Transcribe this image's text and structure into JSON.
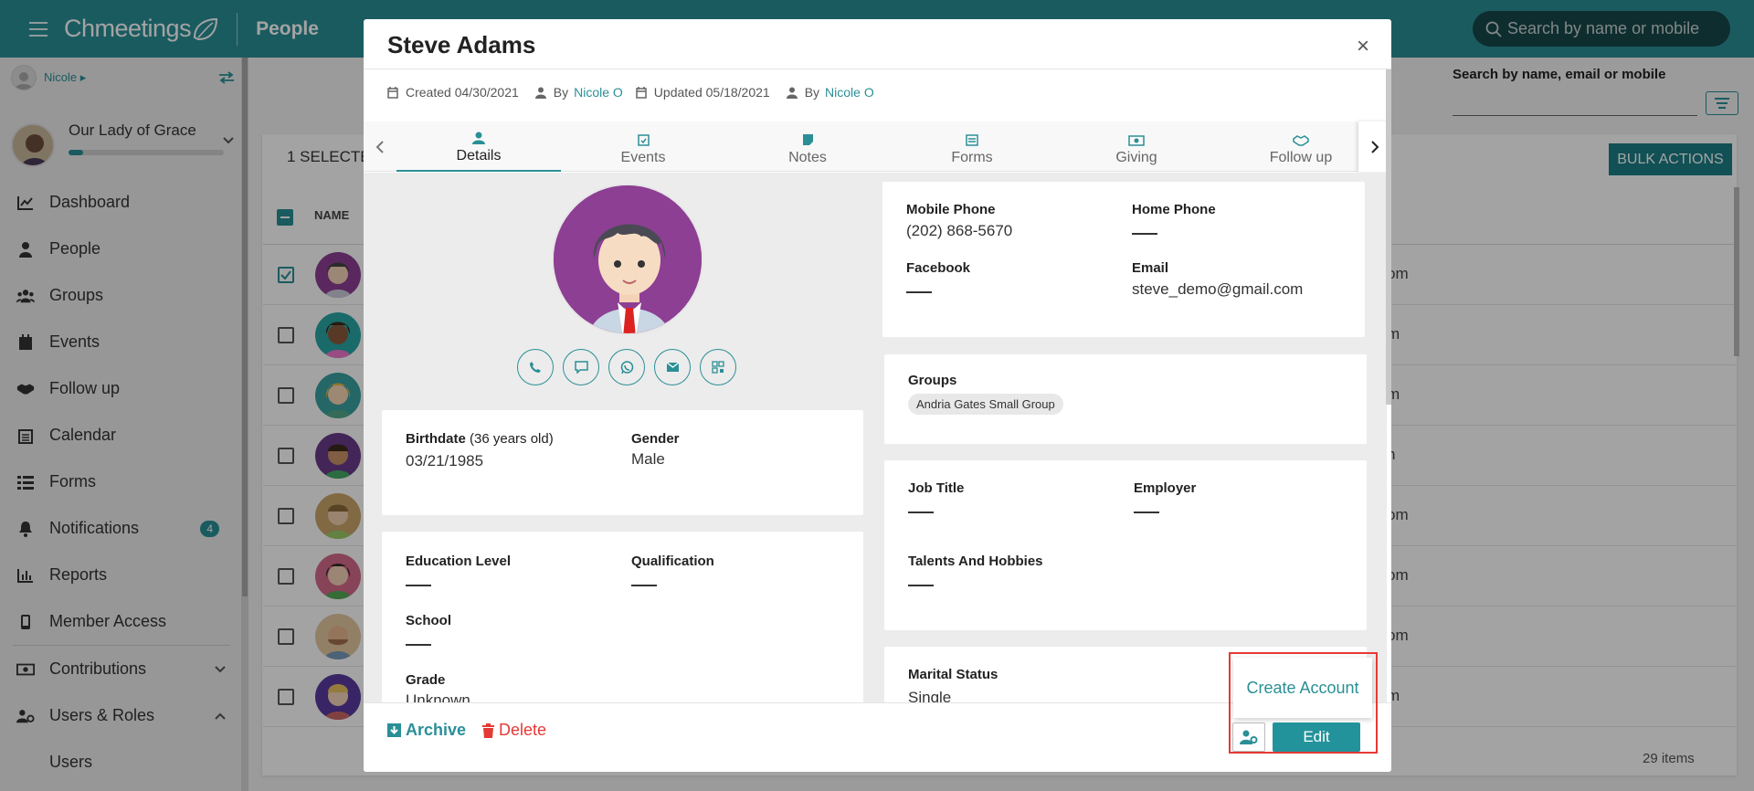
{
  "app": {
    "brand": "Chmeetings",
    "page_title": "People",
    "search_placeholder": "Search by name or mobile"
  },
  "sidebar": {
    "user": "Nicole",
    "church": {
      "name": "Our Lady of Grace"
    },
    "items": [
      {
        "label": "Dashboard",
        "icon": "chart-line-icon"
      },
      {
        "label": "People",
        "icon": "person-icon"
      },
      {
        "label": "Groups",
        "icon": "users-group-icon"
      },
      {
        "label": "Events",
        "icon": "calendar-icon"
      },
      {
        "label": "Follow up",
        "icon": "handshake-icon"
      },
      {
        "label": "Calendar",
        "icon": "calendar-grid-icon"
      },
      {
        "label": "Forms",
        "icon": "list-icon"
      },
      {
        "label": "Notifications",
        "icon": "bell-icon",
        "badge": "4"
      },
      {
        "label": "Reports",
        "icon": "bar-chart-icon"
      },
      {
        "label": "Member Access",
        "icon": "mobile-icon"
      },
      {
        "label": "Contributions",
        "icon": "money-icon"
      },
      {
        "label": "Users & Roles",
        "icon": "user-cog-icon"
      },
      {
        "label": "Users",
        "icon": ""
      }
    ]
  },
  "people_list": {
    "search_label": "Search by name, email or mobile",
    "selected_text": "1 SELECTE",
    "bulk_actions": "BULK ACTIONS",
    "column_name": "NAME",
    "row_emails": [
      "om",
      "m",
      "m",
      "n",
      "om",
      "om",
      "om",
      "m"
    ],
    "total": "29 items"
  },
  "modal": {
    "name": "Steve Adams",
    "close": "×",
    "meta": {
      "created": "Created 04/30/2021",
      "by_label": "By",
      "created_by": "Nicole O",
      "updated": "Updated 05/18/2021",
      "updated_by": "Nicole O"
    },
    "tabs": [
      "Details",
      "Events",
      "Notes",
      "Forms",
      "Giving",
      "Follow up"
    ],
    "birthdate": {
      "label": "Birthdate",
      "age": "(36 years old)",
      "value": "03/21/1985"
    },
    "gender": {
      "label": "Gender",
      "value": "Male"
    },
    "education_level": {
      "label": "Education Level"
    },
    "qualification": {
      "label": "Qualification"
    },
    "school": {
      "label": "School"
    },
    "grade": {
      "label": "Grade",
      "value": "Unknown"
    },
    "mobile_phone": {
      "label": "Mobile Phone",
      "value": "(202) 868-5670"
    },
    "home_phone": {
      "label": "Home Phone"
    },
    "facebook": {
      "label": "Facebook"
    },
    "email": {
      "label": "Email",
      "value": "steve_demo@gmail.com"
    },
    "groups": {
      "label": "Groups",
      "items": [
        "Andria Gates Small Group"
      ]
    },
    "job_title": {
      "label": "Job Title"
    },
    "employer": {
      "label": "Employer"
    },
    "talents": {
      "label": "Talents And Hobbies"
    },
    "marital_status": {
      "label": "Marital Status",
      "value": "Single"
    },
    "footer": {
      "archive": "Archive",
      "delete": "Delete",
      "create_account": "Create Account",
      "edit": "Edit"
    }
  },
  "colors": {
    "teal": "#2a8f96",
    "danger": "#e53935",
    "highlight_box": "#e53935"
  }
}
